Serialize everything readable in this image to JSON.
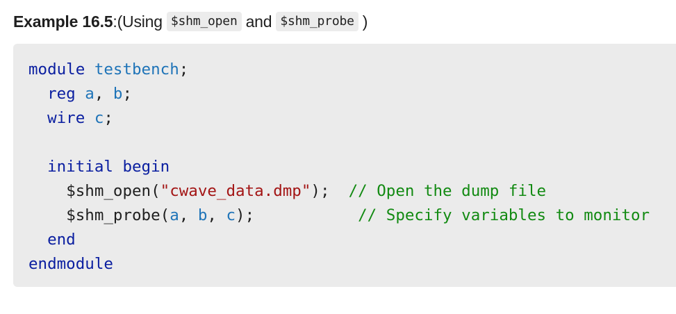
{
  "heading": {
    "label": "Example 16.5",
    "colon": ":",
    "prefix": " (Using",
    "code1": "$shm_open",
    "middle": "and",
    "code2": "$shm_probe",
    "suffix": ")"
  },
  "code": {
    "l1_kw": "module",
    "l1_sp": " ",
    "l1_name": "testbench",
    "l1_end": ";",
    "l2_indent": "  ",
    "l2_kw": "reg",
    "l2_sp": " ",
    "l2_a": "a",
    "l2_comma": ", ",
    "l2_b": "b",
    "l2_end": ";",
    "l3_indent": "  ",
    "l3_kw": "wire",
    "l3_sp": " ",
    "l3_c": "c",
    "l3_end": ";",
    "l5_indent": "  ",
    "l5_kw1": "initial",
    "l5_sp": " ",
    "l5_kw2": "begin",
    "l6_indent": "    ",
    "l6_task": "$shm_open",
    "l6_open": "(",
    "l6_str": "\"cwave_data.dmp\"",
    "l6_close": ");  ",
    "l6_comment": "// Open the dump file",
    "l7_indent": "    ",
    "l7_task": "$shm_probe",
    "l7_open": "(",
    "l7_a": "a",
    "l7_c1": ", ",
    "l7_b": "b",
    "l7_c2": ", ",
    "l7_c": "c",
    "l7_close": ");           ",
    "l7_comment": "// Specify variables to monitor",
    "l8_indent": "  ",
    "l8_kw": "end",
    "l9_kw": "endmodule"
  }
}
